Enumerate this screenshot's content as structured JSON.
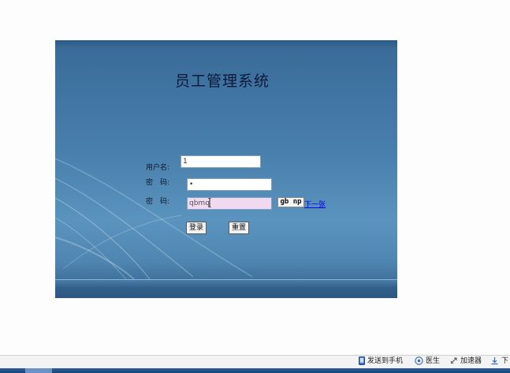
{
  "login": {
    "title": "员工管理系统",
    "username_label": "用户名:",
    "username_value": "1",
    "password_label": "密　码:",
    "password_value": "•",
    "captcha_label": "密　码:",
    "captcha_value": "qbmq",
    "captcha_image_text": "gb np",
    "next_image_link": "下一张",
    "login_button": "登录",
    "reset_button": "重置"
  },
  "statusbar": {
    "items": [
      {
        "label": "发送到手机",
        "icon": "phone-icon"
      },
      {
        "label": "医生",
        "icon": "doctor-icon"
      },
      {
        "label": "加速器",
        "icon": "rocket-icon"
      },
      {
        "label": "下",
        "icon": "download-icon"
      }
    ]
  },
  "colors": {
    "panel_top": "#2b5985",
    "panel_mid": "#4a80ad",
    "captcha_field": "#f1daf0",
    "link": "#0000ee",
    "taskbar": "#1b4278"
  }
}
